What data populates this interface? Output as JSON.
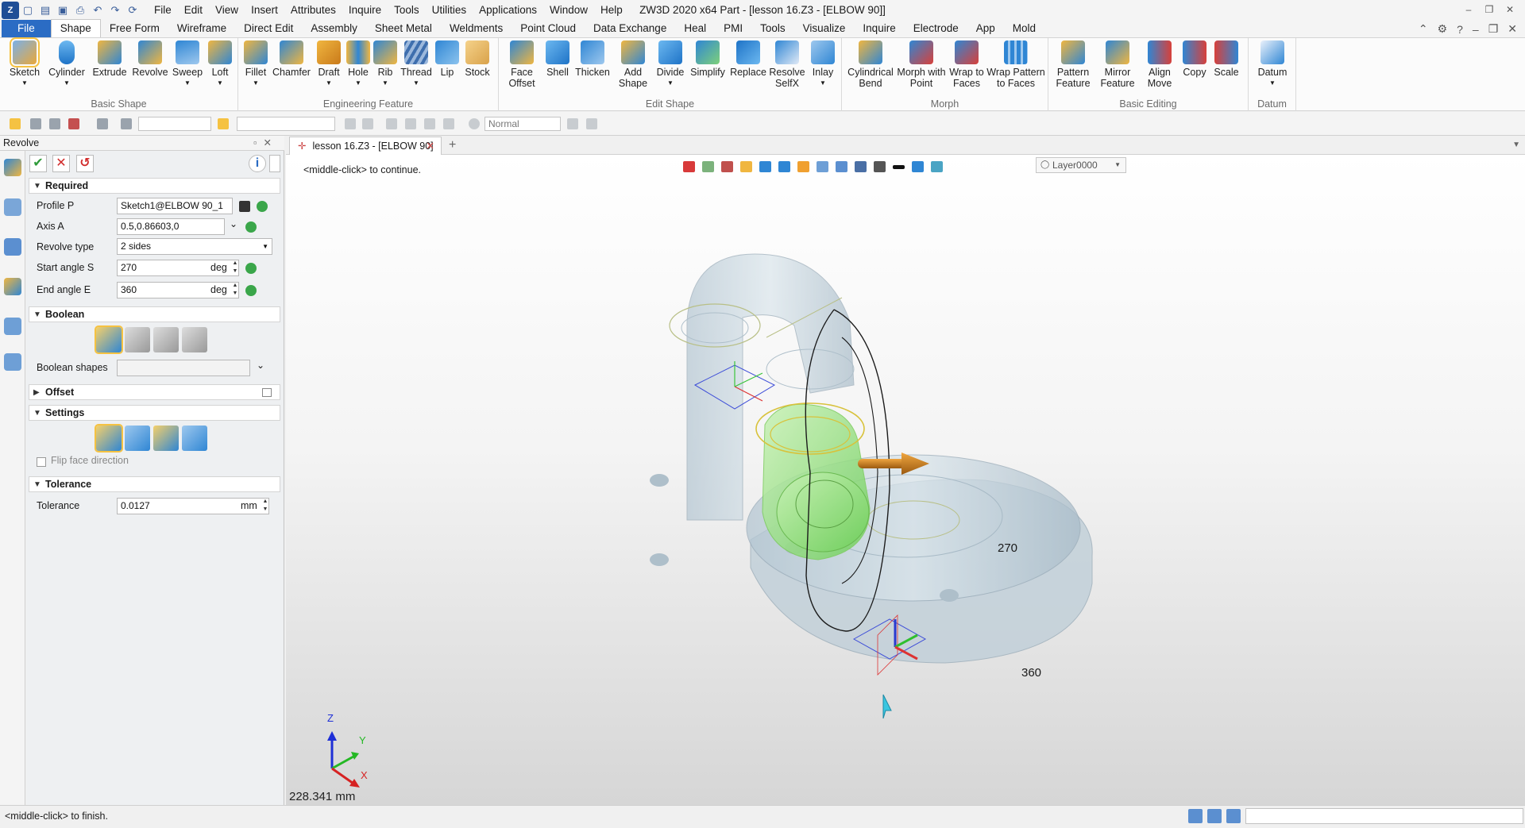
{
  "app": {
    "title": "ZW3D 2020 x64        Part - [lesson 16.Z3 - [ELBOW 90]]",
    "logo_text": "Z"
  },
  "quick_access": [
    "new-icon",
    "open-icon",
    "save-icon",
    "print-icon",
    "undo-icon",
    "redo-icon",
    "repeat-icon"
  ],
  "menu": [
    "File",
    "Edit",
    "View",
    "Insert",
    "Attributes",
    "Inquire",
    "Tools",
    "Utilities",
    "Applications",
    "Window",
    "Help"
  ],
  "ribbon_tabs": [
    "File",
    "Shape",
    "Free Form",
    "Wireframe",
    "Direct Edit",
    "Assembly",
    "Sheet Metal",
    "Weldments",
    "Point Cloud",
    "Data Exchange",
    "Heal",
    "PMI",
    "Tools",
    "Visualize",
    "Inquire",
    "Electrode",
    "App",
    "Mold"
  ],
  "ribbon_active_tab": "Shape",
  "ribbon_groups": [
    {
      "label": "Basic Shape",
      "buttons": [
        "Sketch",
        "Cylinder",
        "Extrude",
        "Revolve",
        "Sweep",
        "Loft"
      ]
    },
    {
      "label": "Engineering Feature",
      "buttons": [
        "Fillet",
        "Chamfer",
        "Draft",
        "Hole",
        "Rib",
        "Thread",
        "Lip",
        "Stock"
      ]
    },
    {
      "label": "Edit Shape",
      "buttons": [
        "Face\nOffset",
        "Shell",
        "Thicken",
        "Add\nShape",
        "Divide",
        "Simplify",
        "Replace",
        "Resolve\nSelfX",
        "Inlay"
      ]
    },
    {
      "label": "Morph",
      "buttons": [
        "Cylindrical\nBend",
        "Morph with\nPoint",
        "Wrap to\nFaces",
        "Wrap Pattern\nto Faces"
      ]
    },
    {
      "label": "Basic Editing",
      "buttons": [
        "Pattern\nFeature",
        "Mirror\nFeature",
        "Align\nMove",
        "Copy",
        "Scale"
      ]
    },
    {
      "label": "Datum",
      "buttons": [
        "Datum"
      ]
    }
  ],
  "toolbar2": {
    "filter_value": "",
    "style_value": "Normal"
  },
  "panel": {
    "title": "Revolve",
    "sections": {
      "required": "Required",
      "boolean": "Boolean",
      "offset": "Offset",
      "settings": "Settings",
      "tolerance": "Tolerance"
    },
    "fields": {
      "profile_label": "Profile P",
      "profile_value": "Sketch1@ELBOW 90_1",
      "axis_label": "Axis A",
      "axis_value": "0.5,0.86603,0",
      "revtype_label": "Revolve type",
      "revtype_value": "2 sides",
      "start_label": "Start angle S",
      "start_value": "270",
      "start_unit": "deg",
      "end_label": "End angle E",
      "end_value": "360",
      "end_unit": "deg",
      "boolean_shapes_label": "Boolean shapes",
      "boolean_shapes_value": "",
      "flip_label": "Flip face direction",
      "tolerance_label": "Tolerance",
      "tolerance_value": "0.0127",
      "tolerance_unit": "mm"
    }
  },
  "doc_tab": "lesson 16.Z3 - [ELBOW 90]",
  "viewport": {
    "prompt": "<middle-click> to continue.",
    "layer": "Layer0000",
    "dim_start": "270",
    "dim_end": "360",
    "measure": "228.341 mm",
    "axes": {
      "x": "X",
      "y": "Y",
      "z": "Z"
    }
  },
  "status": {
    "text": "<middle-click> to finish."
  },
  "colors": {
    "accent": "#2b6cc4",
    "preview_green": "#8be07a",
    "highlight": "#f5c242",
    "arrow": "#c77a12"
  }
}
